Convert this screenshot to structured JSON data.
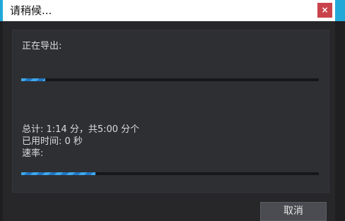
{
  "dialog": {
    "title": "请稍候...",
    "close_label": "×"
  },
  "panel": {
    "heading": "正在导出:",
    "primary_progress": 0.08,
    "total_line": "总计: 1:14 分，共5:00 分个",
    "elapsed_line": "已用时间: 0 秒",
    "rate_line": "速率:",
    "secondary_progress": 0.25
  },
  "footer": {
    "cancel_label": "取消"
  },
  "colors": {
    "accent": "#22a8d8",
    "close_button": "#c9434a",
    "progress_fill": "#3fa7ec"
  }
}
